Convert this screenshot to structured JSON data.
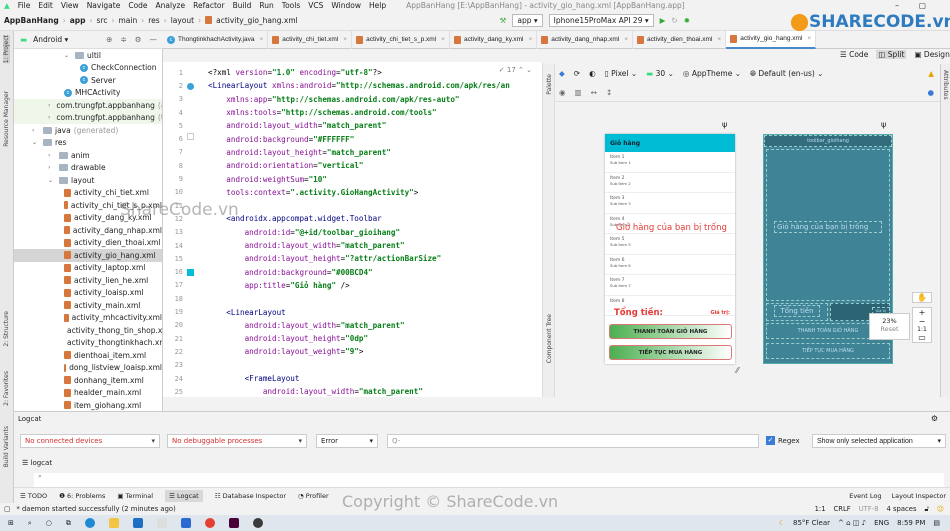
{
  "menu": [
    "File",
    "Edit",
    "View",
    "Navigate",
    "Code",
    "Analyze",
    "Refactor",
    "Build",
    "Run",
    "Tools",
    "VCS",
    "Window",
    "Help"
  ],
  "window_title": "AppBanHang [E:\\AppBanHang] - activity_gio_hang.xml [AppBanHang.app]",
  "breadcrumb": [
    "AppBanHang",
    "app",
    "src",
    "main",
    "res",
    "layout",
    "activity_gio_hang.xml"
  ],
  "run_config": "app",
  "device": "Iphone15ProMax API 29",
  "logo_text": "SHARECODE.vn",
  "project_view": "Android",
  "left_tools": [
    "1: Project",
    "Resource Manager",
    "2: Structure",
    "2: Favorites",
    "Build Variants"
  ],
  "editor_tabs": [
    "ThongtinkhachActivity.java",
    "activity_chi_tiet.xml",
    "activity_chi_tiet_s_p.xml",
    "activity_dang_ky.xml",
    "activity_dang_nhap.xml",
    "activity_dien_thoai.xml",
    "activity_gio_hang.xml"
  ],
  "active_tab": "activity_gio_hang.xml",
  "tree": [
    {
      "label": "ultil",
      "type": "folder",
      "open": true
    },
    {
      "label": "CheckConnection",
      "type": "class"
    },
    {
      "label": "Server",
      "type": "class"
    },
    {
      "label": "MHCActivity",
      "type": "class"
    },
    {
      "label": "com.trungfpt.appbanhang",
      "hint": "(an",
      "type": "folder"
    },
    {
      "label": "com.trungfpt.appbanhang",
      "hint": "(te",
      "type": "folder"
    },
    {
      "label": "java",
      "hint": "(generated)",
      "type": "folder"
    },
    {
      "label": "res",
      "type": "folder",
      "open": true
    },
    {
      "label": "anim",
      "type": "folder"
    },
    {
      "label": "drawable",
      "type": "folder"
    },
    {
      "label": "layout",
      "type": "folder",
      "open": true
    },
    {
      "label": "activity_chi_tiet.xml",
      "type": "file"
    },
    {
      "label": "activity_chi_tiet_s_p.xml",
      "type": "file"
    },
    {
      "label": "activity_dang_ky.xml",
      "type": "file"
    },
    {
      "label": "activity_dang_nhap.xml",
      "type": "file"
    },
    {
      "label": "activity_dien_thoai.xml",
      "type": "file"
    },
    {
      "label": "activity_gio_hang.xml",
      "type": "file",
      "selected": true
    },
    {
      "label": "activity_laptop.xml",
      "type": "file"
    },
    {
      "label": "activity_lien_he.xml",
      "type": "file"
    },
    {
      "label": "activity_loaisp.xml",
      "type": "file"
    },
    {
      "label": "activity_main.xml",
      "type": "file"
    },
    {
      "label": "activity_mhcactivity.xml",
      "type": "file"
    },
    {
      "label": "activity_thong_tin_shop.xml",
      "type": "file"
    },
    {
      "label": "activity_thongtinkhach.xml",
      "type": "file"
    },
    {
      "label": "dienthoai_item.xml",
      "type": "file"
    },
    {
      "label": "dong_listview_loaisp.xml",
      "type": "file"
    },
    {
      "label": "donhang_item.xml",
      "type": "file"
    },
    {
      "label": "healder_main.xml",
      "type": "file"
    },
    {
      "label": "item_giohang.xml",
      "type": "file"
    }
  ],
  "view_modes": [
    "Code",
    "Split",
    "Design"
  ],
  "warnings_count": "17",
  "code_lines": [
    [
      [
        "plain",
        "<?xml "
      ],
      [
        "attr",
        "version"
      ],
      [
        "plain",
        "="
      ],
      [
        "val",
        "\"1.0\""
      ],
      [
        "plain",
        " "
      ],
      [
        "attr",
        "encoding"
      ],
      [
        "plain",
        "="
      ],
      [
        "val",
        "\"utf-8\""
      ],
      [
        "plain",
        "?>"
      ]
    ],
    [
      [
        "tag",
        "<LinearLayout "
      ],
      [
        "attr",
        "xmlns:android"
      ],
      [
        "plain",
        "="
      ],
      [
        "val",
        "\"http://schemas.android.com/apk/res/an"
      ]
    ],
    [
      [
        "plain",
        "    "
      ],
      [
        "attr",
        "xmlns:app"
      ],
      [
        "plain",
        "="
      ],
      [
        "val",
        "\"http://schemas.android.com/apk/res-auto\""
      ]
    ],
    [
      [
        "plain",
        "    "
      ],
      [
        "attr",
        "xmlns:tools"
      ],
      [
        "plain",
        "="
      ],
      [
        "val",
        "\"http://schemas.android.com/tools\""
      ]
    ],
    [
      [
        "plain",
        "    "
      ],
      [
        "attr",
        "android:layout_width"
      ],
      [
        "plain",
        "="
      ],
      [
        "val",
        "\"match_parent\""
      ]
    ],
    [
      [
        "plain",
        "    "
      ],
      [
        "attr",
        "android:background"
      ],
      [
        "plain",
        "="
      ],
      [
        "val",
        "\"#FFFFFF\""
      ]
    ],
    [
      [
        "plain",
        "    "
      ],
      [
        "attr",
        "android:layout_height"
      ],
      [
        "plain",
        "="
      ],
      [
        "val",
        "\"match_parent\""
      ]
    ],
    [
      [
        "plain",
        "    "
      ],
      [
        "attr",
        "android:orientation"
      ],
      [
        "plain",
        "="
      ],
      [
        "val",
        "\"vertical\""
      ]
    ],
    [
      [
        "plain",
        "    "
      ],
      [
        "attr",
        "android:weightSum"
      ],
      [
        "plain",
        "="
      ],
      [
        "val",
        "\"10\""
      ]
    ],
    [
      [
        "plain",
        "    "
      ],
      [
        "attr",
        "tools:context"
      ],
      [
        "plain",
        "="
      ],
      [
        "val",
        "\".activity.GioHangActivity\""
      ],
      [
        "plain",
        ">"
      ]
    ],
    [],
    [
      [
        "plain",
        "    "
      ],
      [
        "tag",
        "<androidx.appcompat.widget.Toolbar"
      ]
    ],
    [
      [
        "plain",
        "        "
      ],
      [
        "attr",
        "android:id"
      ],
      [
        "plain",
        "="
      ],
      [
        "val",
        "\"@+id/toolbar_gioihang\""
      ]
    ],
    [
      [
        "plain",
        "        "
      ],
      [
        "attr",
        "android:layout_width"
      ],
      [
        "plain",
        "="
      ],
      [
        "val",
        "\"match_parent\""
      ]
    ],
    [
      [
        "plain",
        "        "
      ],
      [
        "attr",
        "android:layout_height"
      ],
      [
        "plain",
        "="
      ],
      [
        "val",
        "\"?attr/actionBarSize\""
      ]
    ],
    [
      [
        "plain",
        "        "
      ],
      [
        "attr",
        "android:background"
      ],
      [
        "plain",
        "="
      ],
      [
        "val",
        "\"#00BCD4\""
      ]
    ],
    [
      [
        "plain",
        "        "
      ],
      [
        "attr",
        "app:title"
      ],
      [
        "plain",
        "="
      ],
      [
        "val",
        "\"Giỏ hàng\""
      ],
      [
        "plain",
        " />"
      ]
    ],
    [],
    [
      [
        "plain",
        "    "
      ],
      [
        "tag",
        "<LinearLayout"
      ]
    ],
    [
      [
        "plain",
        "        "
      ],
      [
        "attr",
        "android:layout_width"
      ],
      [
        "plain",
        "="
      ],
      [
        "val",
        "\"match_parent\""
      ]
    ],
    [
      [
        "plain",
        "        "
      ],
      [
        "attr",
        "android:layout_height"
      ],
      [
        "plain",
        "="
      ],
      [
        "val",
        "\"0dp\""
      ]
    ],
    [
      [
        "plain",
        "        "
      ],
      [
        "attr",
        "android:layout_weight"
      ],
      [
        "plain",
        "="
      ],
      [
        "val",
        "\"9\""
      ],
      [
        "plain",
        ">"
      ]
    ],
    [],
    [
      [
        "plain",
        "        "
      ],
      [
        "tag",
        "<FrameLayout"
      ]
    ],
    [
      [
        "plain",
        "            "
      ],
      [
        "attr",
        "android:layout_width"
      ],
      [
        "plain",
        "="
      ],
      [
        "val",
        "\"match_parent\""
      ]
    ]
  ],
  "design_toolbar": {
    "device": "Pixel",
    "api": "30",
    "theme": "AppTheme",
    "locale": "Default (en-us)"
  },
  "side_panels": {
    "palette": "Palette",
    "component_tree": "Component Tree",
    "attributes": "Attributes"
  },
  "preview": {
    "toolbar_title": "Giỏ hàng",
    "toolbar_color": "#00BCD4",
    "items": [
      [
        "Item 1",
        "Sub Item 1"
      ],
      [
        "Item 2",
        "Sub Item 2"
      ],
      [
        "Item 3",
        "Sub Item 3"
      ],
      [
        "Item 4",
        "Sub Item 4"
      ],
      [
        "Item 5",
        "Sub Item 5"
      ],
      [
        "Item 6",
        "Sub Item 6"
      ],
      [
        "Item 7",
        "Sub Item 7"
      ],
      [
        "Item 8",
        ""
      ]
    ],
    "empty_text": "Giỏ hàng của bạn bị trống",
    "total_label": "Tổng tiền:",
    "value_label": "Giá trị:",
    "btn_checkout": "THANH TOÁN GIỎ HÀNG",
    "btn_continue": "TIẾP TỤC MUA HÀNG"
  },
  "blueprint": {
    "toolbar_id": "toolbar_gioihang",
    "empty_text": "Giỏ hàng của bạn bị trống",
    "total_label": "Tổng tiền",
    "value_label": "Giá trị",
    "btn_checkout": "THANH TOÁN GIỎ HÀNG",
    "btn_continue": "TIẾP TỤC MUA HÀNG"
  },
  "zoom": {
    "level": "23%",
    "reset": "Reset",
    "one_to_one": "1:1"
  },
  "logcat": {
    "title": "Logcat",
    "device": "No connected devices",
    "process": "No debuggable processes",
    "level": "Error",
    "search_placeholder": "Q-",
    "regex_label": "Regex",
    "regex_checked": true,
    "filter": "Show only selected application",
    "tab": "logcat"
  },
  "bottom_tabs": [
    "TODO",
    "6: Problems",
    "Terminal",
    "Logcat",
    "Database Inspector",
    "Profiler"
  ],
  "bottom_right": [
    "Event Log",
    "Layout Inspector"
  ],
  "status": {
    "message": "* daemon started successfully (2 minutes ago)",
    "position": "1:1",
    "line_sep": "CRLF",
    "encoding": "UTF-8",
    "indent": "4 spaces"
  },
  "watermark": "Copyright © ShareCode.vn",
  "watermark2": "ShareCode.vn",
  "taskbar": {
    "weather": "85°F Clear",
    "lang": "ENG",
    "time": "8:59 PM"
  }
}
